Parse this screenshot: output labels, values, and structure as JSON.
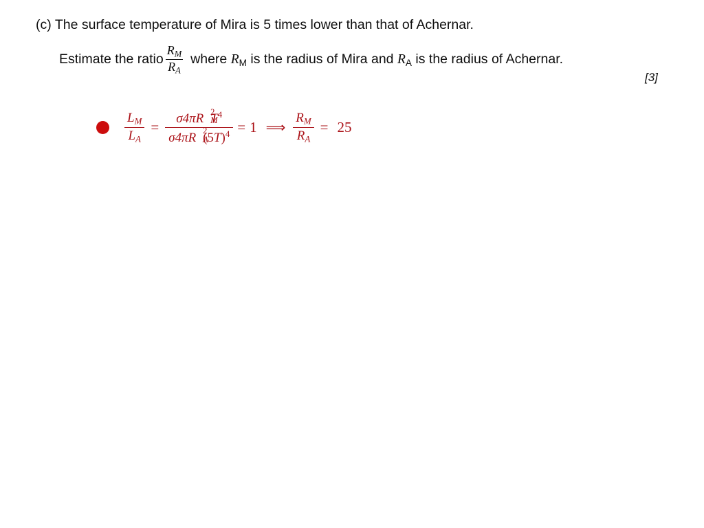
{
  "slide": {
    "question": {
      "part_label": "(c)",
      "line1_text": "The surface temperature of Mira is 5 times lower than that of Achernar.",
      "line2_prefix": "Estimate the ratio",
      "ratio_numerator": "R",
      "ratio_numerator_sub": "M",
      "ratio_denominator": "R",
      "ratio_denominator_sub": "A",
      "line2_mid": "where",
      "symbol_rm": "R",
      "symbol_rm_sub": "M",
      "line2_after_rm": "is the radius of Mira and",
      "symbol_ra": "R",
      "symbol_ra_sub": "A",
      "line2_after_ra": "is the radius of Achernar.",
      "marks": "[3]"
    },
    "answer": {
      "bullet_color": "#cc0d0d",
      "text_color": "#aa1016",
      "lhs_num": "L",
      "lhs_num_sub": "M",
      "lhs_den": "L",
      "lhs_den_sub": "A",
      "rel1": "=",
      "frac_num_sigma": "σ",
      "frac_num_four_pi": "4π",
      "frac_num_R": "R",
      "frac_num_R_sub": "M",
      "frac_num_R_sup": "2",
      "frac_num_T": "T",
      "frac_num_T_sup": "4",
      "frac_den_sigma": "σ",
      "frac_den_four_pi": "4π",
      "frac_den_R": "R",
      "frac_den_R_sub": "A",
      "frac_den_R_sup": "2",
      "frac_den_paren_open": "(",
      "frac_den_five": "5",
      "frac_den_T": "T",
      "frac_den_paren_close": ")",
      "frac_den_paren_sup": "4",
      "rel2": "=",
      "value_one": "1",
      "arrow": "⟹",
      "rhs_num": "R",
      "rhs_num_sub": "M",
      "rhs_den": "R",
      "rhs_den_sub": "A",
      "rel3": "=",
      "result": "25"
    }
  }
}
